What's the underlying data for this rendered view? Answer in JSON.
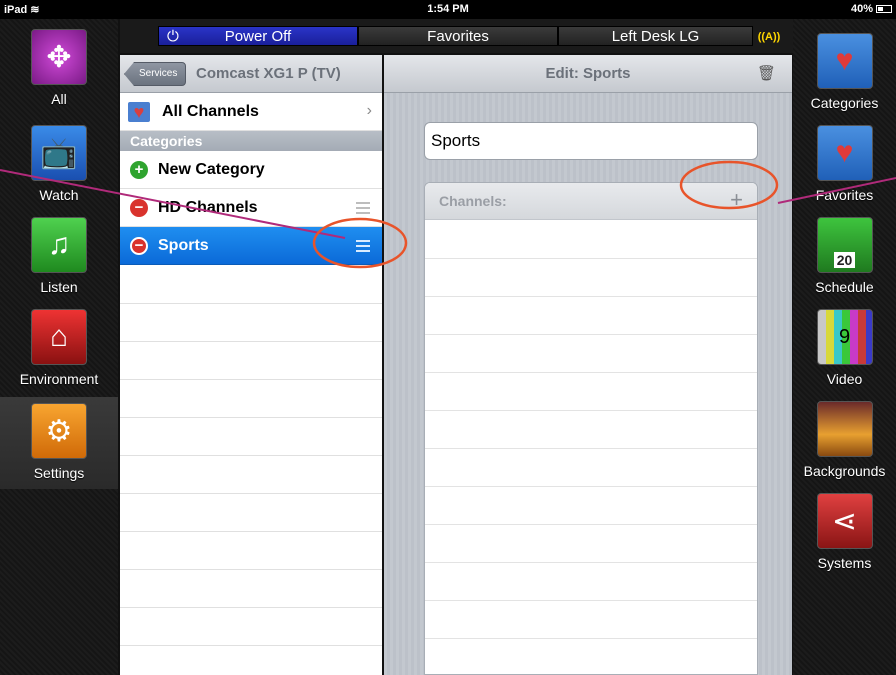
{
  "status_bar": {
    "device": "iPad",
    "wifi_icon": "wifi-icon",
    "time": "1:54 PM",
    "battery": "40%"
  },
  "top_bar": {
    "power_label": "Power Off",
    "power_icon": "power-icon",
    "favorites_label": "Favorites",
    "room_label": "Left Desk LG",
    "antenna_icon": "antenna-icon",
    "antenna_text": "A",
    "power_color": "#2233c0"
  },
  "left_rail": {
    "items": [
      {
        "label": "All",
        "icon": "compass-icon"
      },
      {
        "label": "Watch",
        "icon": "tv-icon"
      },
      {
        "label": "Listen",
        "icon": "music-note-icon"
      },
      {
        "label": "Environment",
        "icon": "home-icon"
      },
      {
        "label": "Settings",
        "icon": "gears-icon",
        "selected": true
      }
    ]
  },
  "right_rail": {
    "items": [
      {
        "label": "Categories",
        "icon": "heart-icon"
      },
      {
        "label": "Favorites",
        "icon": "heart-plus-icon"
      },
      {
        "label": "Schedule",
        "icon": "calendar-icon",
        "badge": "20"
      },
      {
        "label": "Video",
        "icon": "film-icon",
        "badge": "9"
      },
      {
        "label": "Backgrounds",
        "icon": "sunset-icon"
      },
      {
        "label": "Systems",
        "icon": "network-icon"
      }
    ]
  },
  "list_panel": {
    "back_label": "Services",
    "title": "Comcast XG1 P (TV)",
    "all_channels": "All Channels",
    "section_header": "Categories",
    "rows": [
      {
        "label": "New Category",
        "action": "add"
      },
      {
        "label": "HD Channels",
        "action": "remove"
      },
      {
        "label": "Sports",
        "action": "remove",
        "selected": true
      }
    ]
  },
  "edit_panel": {
    "title": "Edit: Sports",
    "name_value": "Sports",
    "channels_header": "Channels:",
    "add_symbol": "+"
  },
  "colors": {
    "selected_row": "#0b6ad8",
    "annotation": "#e8542a",
    "connector": "#b02a7a"
  }
}
